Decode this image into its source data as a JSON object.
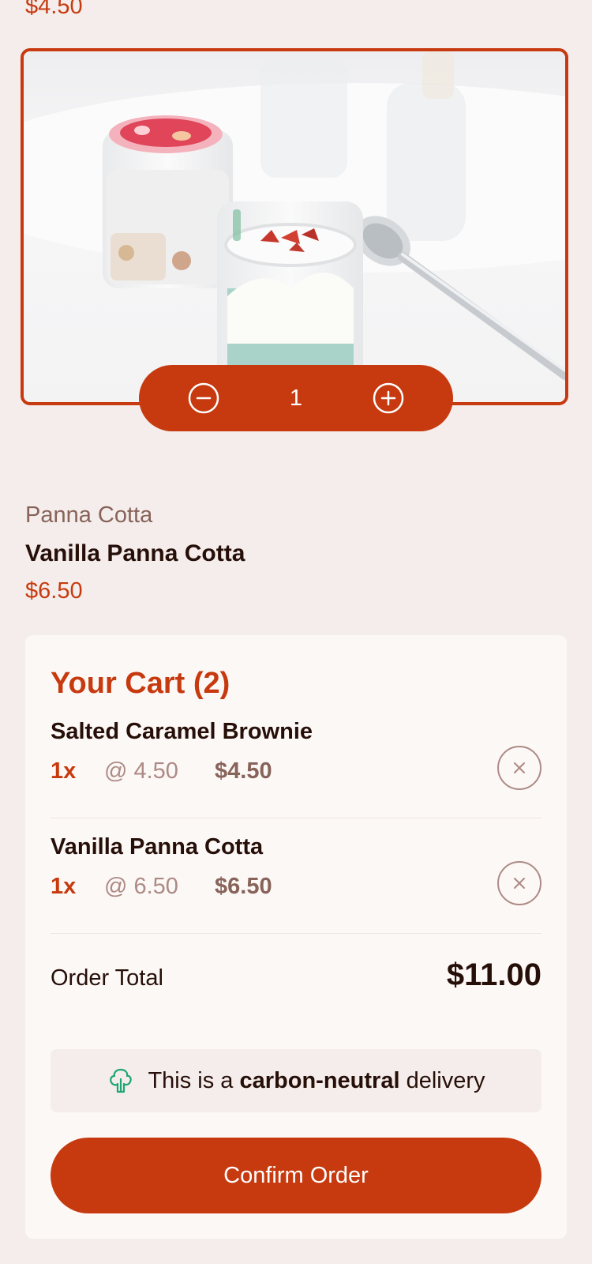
{
  "previous_product": {
    "price": "$4.50"
  },
  "product": {
    "category": "Panna Cotta",
    "name": "Vanilla Panna Cotta",
    "price": "$6.50",
    "quantity": "1",
    "image_alt": "Vanilla panna cotta in glass jars with spoon"
  },
  "cart": {
    "title": "Your Cart (2)",
    "items": [
      {
        "name": "Salted Caramel Brownie",
        "qty": "1x",
        "unit": "@ 4.50",
        "total": "$4.50"
      },
      {
        "name": "Vanilla Panna Cotta",
        "qty": "1x",
        "unit": "@ 6.50",
        "total": "$6.50"
      }
    ],
    "order_total_label": "Order Total",
    "order_total": "$11.00",
    "carbon": {
      "pre": "This is a",
      "bold": "carbon-neutral",
      "post": "delivery"
    },
    "confirm_label": "Confirm Order"
  },
  "icons": {
    "decrement": "minus-circle-icon",
    "increment": "plus-circle-icon",
    "remove": "close-icon",
    "carbon": "tree-icon"
  },
  "colors": {
    "accent": "#c73a0f",
    "background": "#f4edeb",
    "card": "#fcf8f6",
    "text": "#260f08",
    "muted": "#87635a",
    "green": "#1ea575"
  }
}
